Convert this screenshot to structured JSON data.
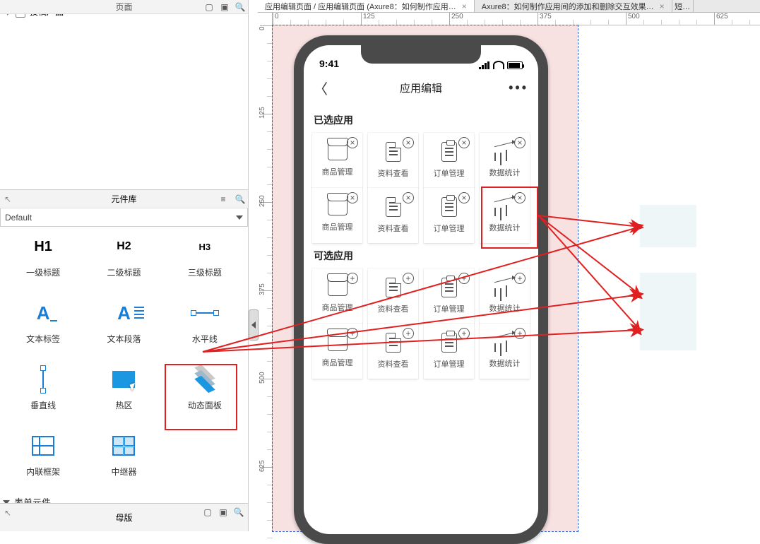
{
  "top_panel": {
    "title": "页面",
    "tree_item": "投稿产品"
  },
  "library": {
    "title": "元件库",
    "selected_set": "Default",
    "widgets": [
      {
        "id": "h1",
        "label": "一级标题"
      },
      {
        "id": "h2",
        "label": "二级标题"
      },
      {
        "id": "h3",
        "label": "三级标题"
      },
      {
        "id": "textlabel",
        "label": "文本标签"
      },
      {
        "id": "paragraph",
        "label": "文本段落"
      },
      {
        "id": "h-line",
        "label": "水平线"
      },
      {
        "id": "v-line",
        "label": "垂直线"
      },
      {
        "id": "hotarea",
        "label": "热区"
      },
      {
        "id": "dynamic",
        "label": "动态面板"
      },
      {
        "id": "iframe",
        "label": "内联框架"
      },
      {
        "id": "repeater",
        "label": "中继器"
      }
    ],
    "section_forms": "表单元件"
  },
  "masters": {
    "title": "母版"
  },
  "tabs": [
    {
      "label": "应用编辑页面 / 应用编辑页面 (Axure8：如何制作应用…",
      "active": true
    },
    {
      "label": "Axure8：如何制作应用间的添加和删除交互效果…",
      "active": false
    }
  ],
  "tab_right_stub": "短…",
  "ruler": {
    "h_marks": [
      "0",
      "125",
      "250",
      "375",
      "500",
      "625"
    ],
    "v_marks": [
      "0",
      "125",
      "250",
      "375",
      "500",
      "625"
    ]
  },
  "phone": {
    "time": "9:41",
    "nav_title": "应用编辑",
    "sections": {
      "selected": {
        "title": "已选应用",
        "rows": [
          [
            "商品管理",
            "资料查看",
            "订单管理",
            "数据统计"
          ],
          [
            "商品管理",
            "资料查看",
            "订单管理",
            "数据统计"
          ]
        ],
        "badge": "x"
      },
      "available": {
        "title": "可选应用",
        "rows": [
          [
            "商品管理",
            "资料查看",
            "订单管理",
            "数据统计"
          ],
          [
            "商品管理",
            "资料查看",
            "订单管理",
            "数据统计"
          ]
        ],
        "badge": "plus"
      }
    }
  },
  "annotations": {
    "highlight_widget": "dynamic",
    "highlight_phone_tile": {
      "section": "selected",
      "row": 1,
      "col": 3
    }
  }
}
